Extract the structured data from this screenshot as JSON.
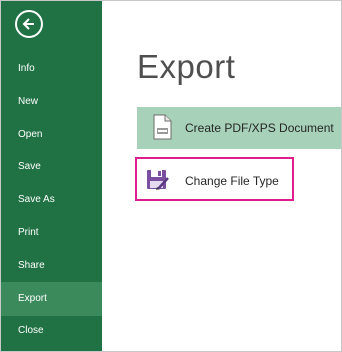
{
  "sidebar": {
    "back_icon": "back-arrow-icon",
    "items": [
      {
        "label": "Info"
      },
      {
        "label": "New"
      },
      {
        "label": "Open"
      },
      {
        "label": "Save"
      },
      {
        "label": "Save As"
      },
      {
        "label": "Print"
      },
      {
        "label": "Share"
      },
      {
        "label": "Export",
        "active": true
      },
      {
        "label": "Close"
      }
    ]
  },
  "main": {
    "title": "Export",
    "options": [
      {
        "label": "Create PDF/XPS Document",
        "icon": "pdf-document-icon",
        "selected": true
      },
      {
        "label": "Change File Type",
        "icon": "change-file-type-icon",
        "highlighted": true
      }
    ]
  },
  "colors": {
    "sidebar_bg": "#207245",
    "active_item_bg": "#3a8a5c",
    "selected_option_bg": "#a7d1b8",
    "highlight_border": "#e01d8c",
    "title_text": "#4f4f4f"
  }
}
